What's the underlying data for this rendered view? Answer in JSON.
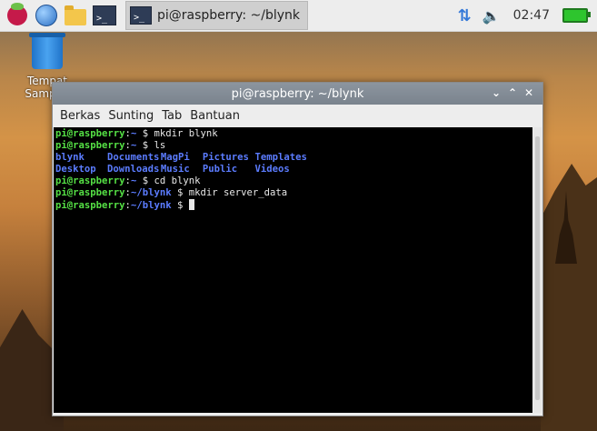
{
  "taskbar": {
    "launchers": [
      "raspberry-menu-icon",
      "web-browser-icon",
      "file-manager-icon",
      "terminal-icon"
    ],
    "task_button_label": "pi@raspberry: ~/blynk",
    "clock": "02:47",
    "tray_icons": [
      "network-arrows-icon",
      "volume-icon",
      "battery-icon"
    ]
  },
  "desktop": {
    "trash_label": "Tempat Sampah"
  },
  "window": {
    "title": "pi@raspberry: ~/blynk",
    "menu": [
      "Berkas",
      "Sunting",
      "Tab",
      "Bantuan"
    ]
  },
  "terminal": {
    "lines": [
      {
        "prompt": "pi@raspberry",
        "path": "~",
        "cmd": "mkdir blynk"
      },
      {
        "prompt": "pi@raspberry",
        "path": "~",
        "cmd": "ls"
      },
      {
        "listing": [
          "blynk",
          "Documents",
          "MagPi",
          "Pictures",
          "Templates"
        ]
      },
      {
        "listing": [
          "Desktop",
          "Downloads",
          "Music",
          "Public",
          "Videos"
        ]
      },
      {
        "prompt": "pi@raspberry",
        "path": "~",
        "cmd": "cd blynk"
      },
      {
        "prompt": "pi@raspberry",
        "path": "~/blynk",
        "cmd": "mkdir server_data"
      },
      {
        "prompt": "pi@raspberry",
        "path": "~/blynk",
        "cmd": "",
        "cursor": true
      }
    ]
  },
  "colors": {
    "prompt_green": "#55e045",
    "path_blue": "#5b7cff",
    "terminal_bg": "#000000"
  }
}
